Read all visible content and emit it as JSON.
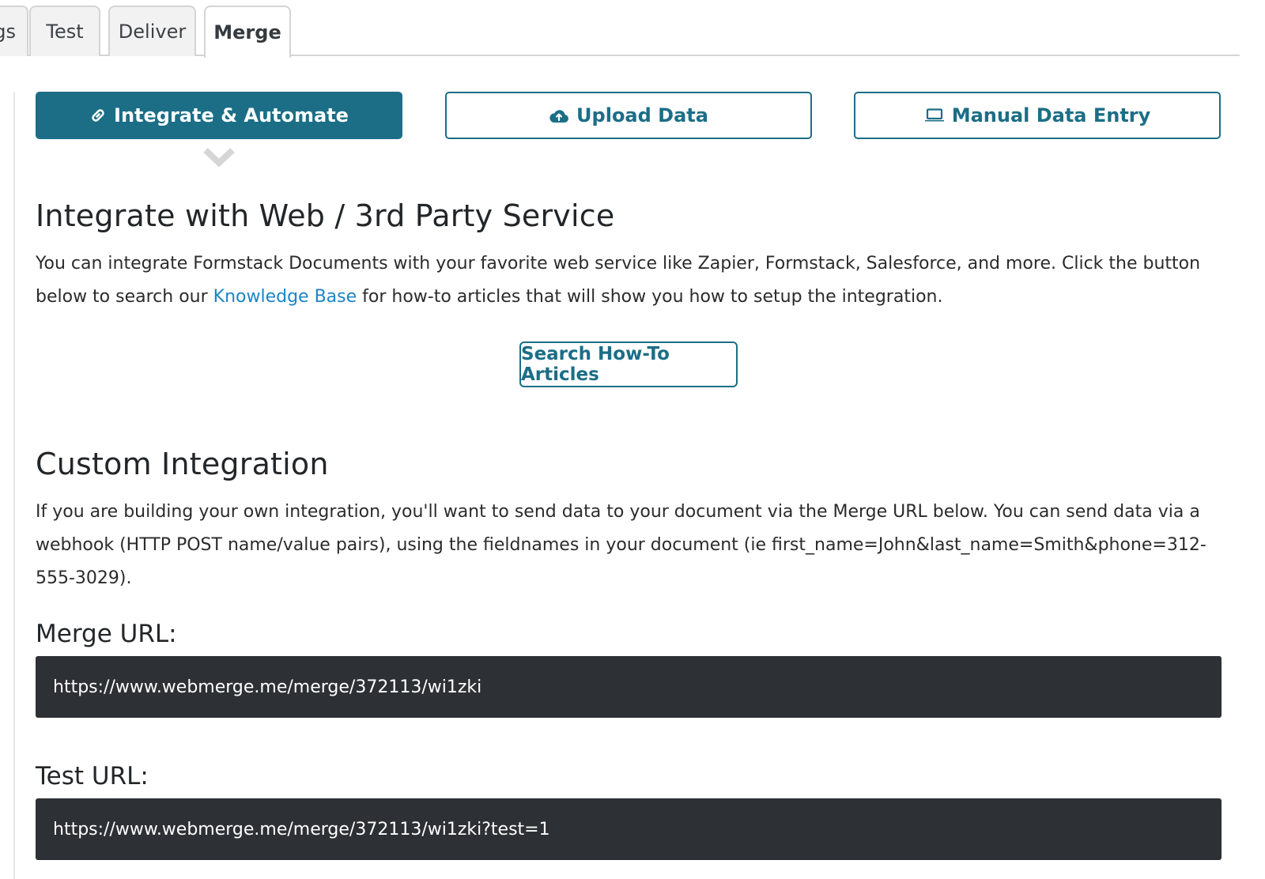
{
  "tabs": [
    {
      "label": "gs",
      "active": false
    },
    {
      "label": "Test",
      "active": false
    },
    {
      "label": "Deliver",
      "active": false
    },
    {
      "label": "Merge",
      "active": true
    }
  ],
  "modes": {
    "integrate": {
      "label": "Integrate & Automate",
      "icon": "link-icon",
      "active": true
    },
    "upload": {
      "label": "Upload Data",
      "icon": "cloud-upload-icon",
      "active": false
    },
    "manual": {
      "label": "Manual Data Entry",
      "icon": "laptop-icon",
      "active": false
    }
  },
  "integrate_section": {
    "title": "Integrate with Web / 3rd Party Service",
    "text_before_link": "You can integrate Formstack Documents with your favorite web service like Zapier, Formstack, Salesforce, and more. Click the button below to search our ",
    "link_text": "Knowledge Base",
    "text_after_link": " for how-to articles that will show you how to setup the integration.",
    "search_button": "Search How-To Articles"
  },
  "custom_section": {
    "title": "Custom Integration",
    "description": "If you are building your own integration, you'll want to send data to your document via the Merge URL below. You can send data via a webhook (HTTP POST name/value pairs), using the fieldnames in your document (ie first_name=John&last_name=Smith&phone=312-555-3029).",
    "merge_url_label": "Merge URL:",
    "merge_url": "https://www.webmerge.me/merge/372113/wi1zki",
    "test_url_label": "Test URL:",
    "test_url": "https://www.webmerge.me/merge/372113/wi1zki?test=1"
  },
  "colors": {
    "accent": "#1b6e86",
    "link": "#1c84c6",
    "url_box_bg": "#2d3135"
  }
}
